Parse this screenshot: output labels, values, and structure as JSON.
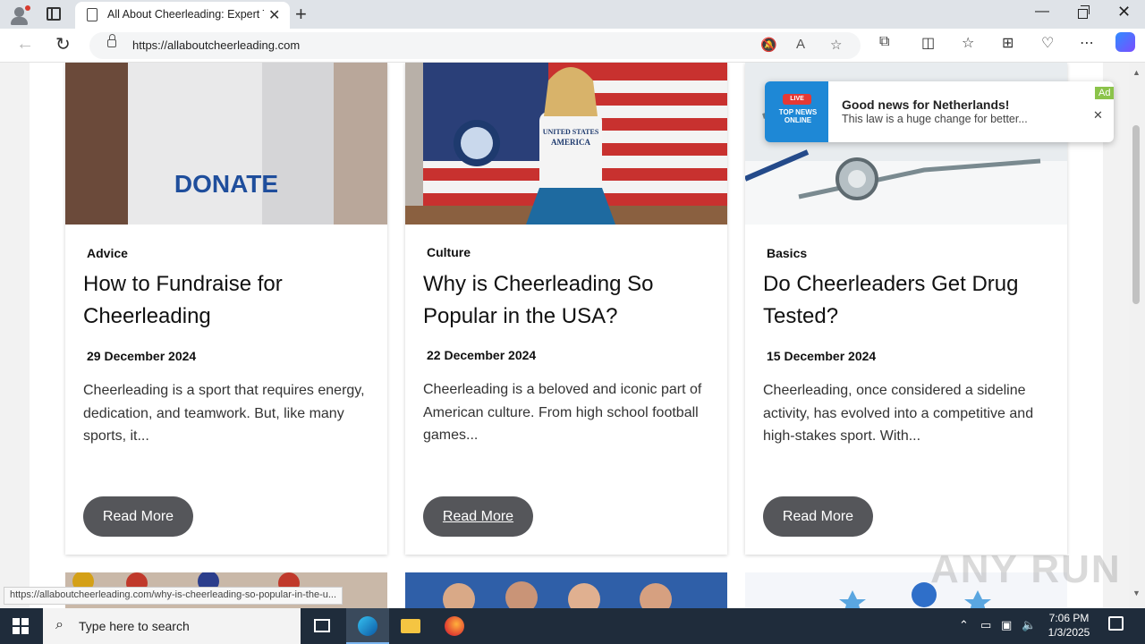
{
  "browser": {
    "tab_title": "All About Cheerleading: Expert Ti",
    "url": "https://allaboutcheerleading.com",
    "status_url": "https://allaboutcheerleading.com/why-is-cheerleading-so-popular-in-the-u..."
  },
  "cards": [
    {
      "category": "Advice",
      "title": "How to Fundraise for Cheerleading",
      "date": "29 December 2024",
      "excerpt": "Cheerleading is a sport that requires energy, dedication, and teamwork. But, like many sports, it...",
      "button": "Read More",
      "image_text": "DONATE"
    },
    {
      "category": "Culture",
      "title": "Why is Cheerleading So Popular in the USA?",
      "date": "22 December 2024",
      "excerpt": "Cheerleading is a beloved and iconic part of American culture. From high school football games...",
      "button": "Read More",
      "image_text": "UNITED STATES AMERICA"
    },
    {
      "category": "Basics",
      "title": "Do Cheerleaders Get Drug Tested?",
      "date": "15 December 2024",
      "excerpt": "Cheerleading, once considered a sideline activity, has evolved into a competitive and high-stakes sport. With...",
      "button": "Read More"
    }
  ],
  "ad": {
    "title": "Good news for Netherlands!",
    "subtitle": "This law is a huge change for better...",
    "tag": "Ad",
    "logo_badge": "LIVE",
    "logo_text": "TOP NEWS ONLINE"
  },
  "watermark": "ANY RUN",
  "taskbar": {
    "search_placeholder": "Type here to search",
    "time": "7:06 PM",
    "date": "1/3/2025"
  },
  "colors": {
    "button_bg": "#55565a",
    "taskbar_bg": "#1f2c3b",
    "ad_tag": "#8bc34a",
    "ad_logo": "#1e88d6"
  }
}
